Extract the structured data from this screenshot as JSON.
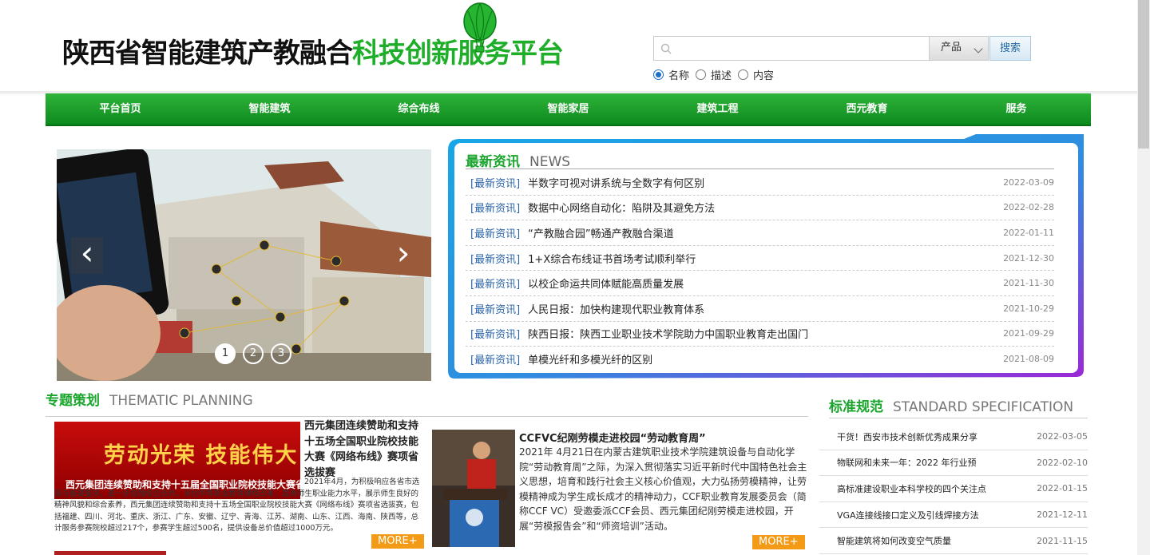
{
  "header": {
    "logo_part1": "陕西省智能建筑产教融合",
    "logo_part2": "科技创新服务平台",
    "search": {
      "placeholder": "",
      "select_value": "产品",
      "button_label": "搜索"
    },
    "radios": [
      {
        "label": "名称",
        "checked": true
      },
      {
        "label": "描述",
        "checked": false
      },
      {
        "label": "内容",
        "checked": false
      }
    ]
  },
  "nav": [
    "平台首页",
    "智能建筑",
    "综合布线",
    "智能家居",
    "建筑工程",
    "西元教育",
    "服务"
  ],
  "slideshow": {
    "dots": [
      "1",
      "2",
      "3"
    ],
    "active": 0
  },
  "news": {
    "title_cn": "最新资讯",
    "title_en": "NEWS",
    "items": [
      {
        "tag": "[最新资讯]",
        "title": "半数字可视对讲系统与全数字有何区别",
        "date": "2022-03-09"
      },
      {
        "tag": "[最新资讯]",
        "title": "数据中心网络自动化：陷阱及其避免方法",
        "date": "2022-02-28"
      },
      {
        "tag": "[最新资讯]",
        "title": "“产教融合园”畅通产教融合渠道",
        "date": "2022-01-11"
      },
      {
        "tag": "[最新资讯]",
        "title": "1+X综合布线证书首场考试顺利举行",
        "date": "2021-12-30"
      },
      {
        "tag": "[最新资讯]",
        "title": "以校企命运共同体赋能高质量发展",
        "date": "2021-11-30"
      },
      {
        "tag": "[最新资讯]",
        "title": "人民日报：加快构建现代职业教育体系",
        "date": "2021-10-29"
      },
      {
        "tag": "[最新资讯]",
        "title": "陕西日报：陕西工业职业技术学院助力中国职业教育走出国门",
        "date": "2021-09-29"
      },
      {
        "tag": "[最新资讯]",
        "title": "单模光纤和多模光纤的区别",
        "date": "2021-08-09"
      }
    ]
  },
  "thematic": {
    "title_cn": "专题策划",
    "title_en": "THEMATIC PLANNING",
    "article1": {
      "img_big": "劳动光荣  技能伟大",
      "img_small": "西元集团连续赞助和支持十五届全国职业院校技能大赛省选拔赛",
      "title": "西元集团连续赞助和支持十五场全国职业院校技能大赛《网络布线》赛项省选拔赛",
      "body": "2021年4月，为积极响应各省市选拔与备赛要求，进一步加强校企合作，深化中等职业教育课程改革，提高师生职业能力水平，展示师生良好的精神风貌和综合素养，西元集团连续赞助和支持十五场全国职业院校技能大赛《网络布线》赛项省选拔赛，包括福建、四川、河北、重庆、浙江、广东、安徽、辽宁、青海、江苏、湖南、山东、江西、海南、陕西等，总计服务参赛院校超过217个，参赛学生超过500名，提供设备总价值超过1000万元。",
      "more": "MORE+"
    },
    "article2": {
      "title": "CCFVC纪刚劳模走进校园“劳动教育周”",
      "body": "2021年 4月21日在内蒙古建筑职业技术学院建筑设备与自动化学院“劳动教育周”之际，为深入贯彻落实习近平新时代中国特色社会主义思想，培育和践行社会主义核心价值观，大力弘扬劳模精神，让劳模精神成为学生成长成才的精神动力，CCF职业教育发展委员会（简称CCF VC）受邀委派CCF会员、西元集团纪刚劳模走进校园，开展“劳模报告会”和“师资培训”活动。",
      "more": "MORE+"
    }
  },
  "standard": {
    "title_cn": "标准规范",
    "title_en": "STANDARD SPECIFICATION",
    "items": [
      {
        "title": "干货！西安市技术创新优秀成果分享",
        "date": "2022-03-05"
      },
      {
        "title": "物联网和未来一年：2022 年行业预",
        "date": "2022-02-10"
      },
      {
        "title": "高标准建设职业本科学校的四个关注点",
        "date": "2022-01-15"
      },
      {
        "title": "VGA连接线接口定义及引线焊接方法",
        "date": "2021-12-11"
      },
      {
        "title": "智能建筑将如何改变空气质量",
        "date": "2021-11-15"
      }
    ]
  },
  "colors": {
    "brand_green": "#1aa52c",
    "nav_green": "#0d8a1e",
    "more_orange": "#f39a16",
    "tag_blue": "#2a64a8"
  }
}
